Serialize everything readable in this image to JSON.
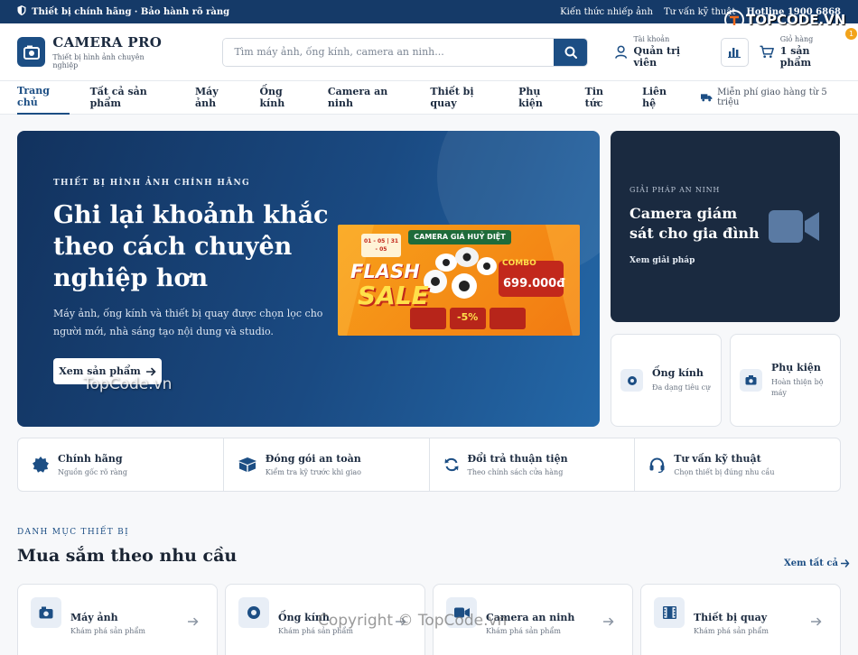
{
  "topbar": {
    "left_text": "Thiết bị chính hãng · Bảo hành rõ ràng",
    "link_knowledge": "Kiến thức nhiếp ảnh",
    "link_advice": "Tư vấn kỹ thuật",
    "hotline": "Hotline 1900 6868"
  },
  "header": {
    "brand_name": "CAMERA PRO",
    "brand_tagline": "Thiết bị hình ảnh chuyên nghiệp",
    "search_placeholder": "Tìm máy ảnh, ống kính, camera an ninh...",
    "account_label": "Tài khoản",
    "account_name": "Quản trị viên",
    "cart_label": "Giỏ hàng",
    "cart_value": "1 sản phẩm",
    "cart_badge": "1"
  },
  "nav": {
    "items": [
      {
        "label": "Trang chủ"
      },
      {
        "label": "Tất cả sản phẩm"
      },
      {
        "label": "Máy ảnh"
      },
      {
        "label": "Ống kính"
      },
      {
        "label": "Camera an ninh"
      },
      {
        "label": "Thiết bị quay"
      },
      {
        "label": "Phụ kiện"
      },
      {
        "label": "Tin tức"
      },
      {
        "label": "Liên hệ"
      }
    ],
    "shipping_note": "Miễn phí giao hàng từ 5 triệu"
  },
  "hero": {
    "eyebrow": "THIẾT BỊ HÌNH ẢNH CHÍNH HÃNG",
    "title": "Ghi lại khoảnh khắc theo cách chuyên nghiệp hơn",
    "description": "Máy ảnh, ống kính và thiết bị quay được chọn lọc cho người mới, nhà sáng tạo nội dung và studio.",
    "cta": "Xem sản phẩm",
    "promo": {
      "banner": "CAMERA GIÁ HUỶ DIỆT",
      "dates": "01 - 05 | 31 - 05",
      "flash": "FLASH",
      "sale": "SALE",
      "combo": "COMBO",
      "price": "699.000đ",
      "discount": "-5%"
    }
  },
  "security_card": {
    "eyebrow": "GIẢI PHÁP AN NINH",
    "title": "Camera giám sát cho gia đình",
    "link": "Xem giải pháp"
  },
  "mini_cards": [
    {
      "title": "Ống kính",
      "subtitle": "Đa dạng tiêu cự"
    },
    {
      "title": "Phụ kiện",
      "subtitle": "Hoàn thiện bộ máy"
    }
  ],
  "features": [
    {
      "title": "Chính hãng",
      "subtitle": "Nguồn gốc rõ ràng",
      "icon": "badge-icon"
    },
    {
      "title": "Đóng gói an toàn",
      "subtitle": "Kiểm tra kỹ trước khi giao",
      "icon": "box-icon"
    },
    {
      "title": "Đổi trả thuận tiện",
      "subtitle": "Theo chính sách cửa hàng",
      "icon": "refresh-icon"
    },
    {
      "title": "Tư vấn kỹ thuật",
      "subtitle": "Chọn thiết bị đúng nhu cầu",
      "icon": "headset-icon"
    }
  ],
  "categories_section": {
    "eyebrow": "DANH MỤC THIẾT BỊ",
    "title": "Mua sắm theo nhu cầu",
    "see_all": "Xem tất cả",
    "items": [
      {
        "title": "Máy ảnh",
        "subtitle": "Khám phá sản phẩm",
        "icon": "camera-icon"
      },
      {
        "title": "Ống kính",
        "subtitle": "Khám phá sản phẩm",
        "icon": "lens-icon"
      },
      {
        "title": "Camera an ninh",
        "subtitle": "Khám phá sản phẩm",
        "icon": "video-icon"
      },
      {
        "title": "Thiết bị quay",
        "subtitle": "Khám phá sản phẩm",
        "icon": "film-icon"
      }
    ]
  },
  "watermarks": {
    "topcode_logo": "TOPCODE.VN",
    "hero_watermark": "TopCode.vn",
    "copyright": "Copyright © TopCode.vn"
  },
  "colors": {
    "primary": "#1c4e84",
    "topbar": "#153a68",
    "dark_card": "#1a2a40",
    "accent": "#f2a31a"
  }
}
